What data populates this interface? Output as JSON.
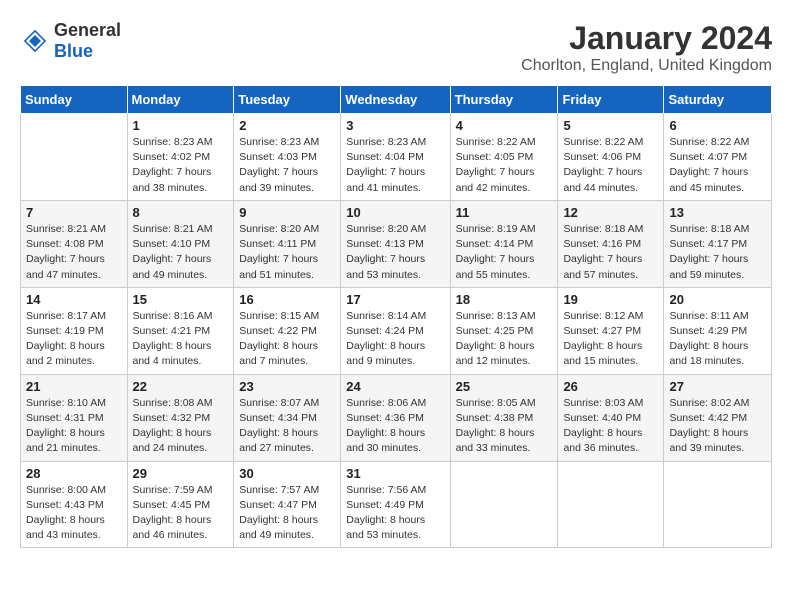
{
  "logo": {
    "general": "General",
    "blue": "Blue"
  },
  "header": {
    "month": "January 2024",
    "location": "Chorlton, England, United Kingdom"
  },
  "weekdays": [
    "Sunday",
    "Monday",
    "Tuesday",
    "Wednesday",
    "Thursday",
    "Friday",
    "Saturday"
  ],
  "weeks": [
    [
      {
        "day": "",
        "sunrise": "",
        "sunset": "",
        "daylight": ""
      },
      {
        "day": "1",
        "sunrise": "Sunrise: 8:23 AM",
        "sunset": "Sunset: 4:02 PM",
        "daylight": "Daylight: 7 hours and 38 minutes."
      },
      {
        "day": "2",
        "sunrise": "Sunrise: 8:23 AM",
        "sunset": "Sunset: 4:03 PM",
        "daylight": "Daylight: 7 hours and 39 minutes."
      },
      {
        "day": "3",
        "sunrise": "Sunrise: 8:23 AM",
        "sunset": "Sunset: 4:04 PM",
        "daylight": "Daylight: 7 hours and 41 minutes."
      },
      {
        "day": "4",
        "sunrise": "Sunrise: 8:22 AM",
        "sunset": "Sunset: 4:05 PM",
        "daylight": "Daylight: 7 hours and 42 minutes."
      },
      {
        "day": "5",
        "sunrise": "Sunrise: 8:22 AM",
        "sunset": "Sunset: 4:06 PM",
        "daylight": "Daylight: 7 hours and 44 minutes."
      },
      {
        "day": "6",
        "sunrise": "Sunrise: 8:22 AM",
        "sunset": "Sunset: 4:07 PM",
        "daylight": "Daylight: 7 hours and 45 minutes."
      }
    ],
    [
      {
        "day": "7",
        "sunrise": "Sunrise: 8:21 AM",
        "sunset": "Sunset: 4:08 PM",
        "daylight": "Daylight: 7 hours and 47 minutes."
      },
      {
        "day": "8",
        "sunrise": "Sunrise: 8:21 AM",
        "sunset": "Sunset: 4:10 PM",
        "daylight": "Daylight: 7 hours and 49 minutes."
      },
      {
        "day": "9",
        "sunrise": "Sunrise: 8:20 AM",
        "sunset": "Sunset: 4:11 PM",
        "daylight": "Daylight: 7 hours and 51 minutes."
      },
      {
        "day": "10",
        "sunrise": "Sunrise: 8:20 AM",
        "sunset": "Sunset: 4:13 PM",
        "daylight": "Daylight: 7 hours and 53 minutes."
      },
      {
        "day": "11",
        "sunrise": "Sunrise: 8:19 AM",
        "sunset": "Sunset: 4:14 PM",
        "daylight": "Daylight: 7 hours and 55 minutes."
      },
      {
        "day": "12",
        "sunrise": "Sunrise: 8:18 AM",
        "sunset": "Sunset: 4:16 PM",
        "daylight": "Daylight: 7 hours and 57 minutes."
      },
      {
        "day": "13",
        "sunrise": "Sunrise: 8:18 AM",
        "sunset": "Sunset: 4:17 PM",
        "daylight": "Daylight: 7 hours and 59 minutes."
      }
    ],
    [
      {
        "day": "14",
        "sunrise": "Sunrise: 8:17 AM",
        "sunset": "Sunset: 4:19 PM",
        "daylight": "Daylight: 8 hours and 2 minutes."
      },
      {
        "day": "15",
        "sunrise": "Sunrise: 8:16 AM",
        "sunset": "Sunset: 4:21 PM",
        "daylight": "Daylight: 8 hours and 4 minutes."
      },
      {
        "day": "16",
        "sunrise": "Sunrise: 8:15 AM",
        "sunset": "Sunset: 4:22 PM",
        "daylight": "Daylight: 8 hours and 7 minutes."
      },
      {
        "day": "17",
        "sunrise": "Sunrise: 8:14 AM",
        "sunset": "Sunset: 4:24 PM",
        "daylight": "Daylight: 8 hours and 9 minutes."
      },
      {
        "day": "18",
        "sunrise": "Sunrise: 8:13 AM",
        "sunset": "Sunset: 4:25 PM",
        "daylight": "Daylight: 8 hours and 12 minutes."
      },
      {
        "day": "19",
        "sunrise": "Sunrise: 8:12 AM",
        "sunset": "Sunset: 4:27 PM",
        "daylight": "Daylight: 8 hours and 15 minutes."
      },
      {
        "day": "20",
        "sunrise": "Sunrise: 8:11 AM",
        "sunset": "Sunset: 4:29 PM",
        "daylight": "Daylight: 8 hours and 18 minutes."
      }
    ],
    [
      {
        "day": "21",
        "sunrise": "Sunrise: 8:10 AM",
        "sunset": "Sunset: 4:31 PM",
        "daylight": "Daylight: 8 hours and 21 minutes."
      },
      {
        "day": "22",
        "sunrise": "Sunrise: 8:08 AM",
        "sunset": "Sunset: 4:32 PM",
        "daylight": "Daylight: 8 hours and 24 minutes."
      },
      {
        "day": "23",
        "sunrise": "Sunrise: 8:07 AM",
        "sunset": "Sunset: 4:34 PM",
        "daylight": "Daylight: 8 hours and 27 minutes."
      },
      {
        "day": "24",
        "sunrise": "Sunrise: 8:06 AM",
        "sunset": "Sunset: 4:36 PM",
        "daylight": "Daylight: 8 hours and 30 minutes."
      },
      {
        "day": "25",
        "sunrise": "Sunrise: 8:05 AM",
        "sunset": "Sunset: 4:38 PM",
        "daylight": "Daylight: 8 hours and 33 minutes."
      },
      {
        "day": "26",
        "sunrise": "Sunrise: 8:03 AM",
        "sunset": "Sunset: 4:40 PM",
        "daylight": "Daylight: 8 hours and 36 minutes."
      },
      {
        "day": "27",
        "sunrise": "Sunrise: 8:02 AM",
        "sunset": "Sunset: 4:42 PM",
        "daylight": "Daylight: 8 hours and 39 minutes."
      }
    ],
    [
      {
        "day": "28",
        "sunrise": "Sunrise: 8:00 AM",
        "sunset": "Sunset: 4:43 PM",
        "daylight": "Daylight: 8 hours and 43 minutes."
      },
      {
        "day": "29",
        "sunrise": "Sunrise: 7:59 AM",
        "sunset": "Sunset: 4:45 PM",
        "daylight": "Daylight: 8 hours and 46 minutes."
      },
      {
        "day": "30",
        "sunrise": "Sunrise: 7:57 AM",
        "sunset": "Sunset: 4:47 PM",
        "daylight": "Daylight: 8 hours and 49 minutes."
      },
      {
        "day": "31",
        "sunrise": "Sunrise: 7:56 AM",
        "sunset": "Sunset: 4:49 PM",
        "daylight": "Daylight: 8 hours and 53 minutes."
      },
      {
        "day": "",
        "sunrise": "",
        "sunset": "",
        "daylight": ""
      },
      {
        "day": "",
        "sunrise": "",
        "sunset": "",
        "daylight": ""
      },
      {
        "day": "",
        "sunrise": "",
        "sunset": "",
        "daylight": ""
      }
    ]
  ]
}
